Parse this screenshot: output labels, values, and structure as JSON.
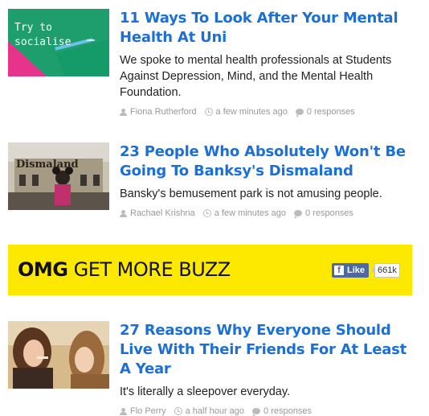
{
  "articles": [
    {
      "title": "11 Ways To Look After Your Mental Health At Uni",
      "description": "We spoke to mental health professionals at Students Against Depression, Mind, and the Mental Health Foundation.",
      "thumb_text_line1": "Try to",
      "thumb_text_line2": "socialise",
      "author": "Fiona Rutherford",
      "time": "a few minutes ago",
      "responses": "0 responses"
    },
    {
      "title": "23 People Who Absolutely Won't Be Going To Banksy's Dismaland",
      "description": "Bansky's bemusement park is not amusing people.",
      "thumb_sign": "Dismaland",
      "author": "Rachael Krishna",
      "time": "a few minutes ago",
      "responses": "0 responses"
    },
    {
      "title": "27 Reasons Why Everyone Should Live With Their Friends For At Least A Year",
      "description": "It's literally a sleepover everyday.",
      "author": "Flo Perry",
      "time": "a half hour ago",
      "responses": "0 responses"
    }
  ],
  "banner": {
    "bold": "OMG",
    "text": " GET MORE BUZZ",
    "like_label": "Like",
    "like_count": "661k",
    "background": "#fde900"
  },
  "colors": {
    "link": "#1a70d6",
    "meta": "#999999",
    "facebook": "#4e69a2"
  }
}
